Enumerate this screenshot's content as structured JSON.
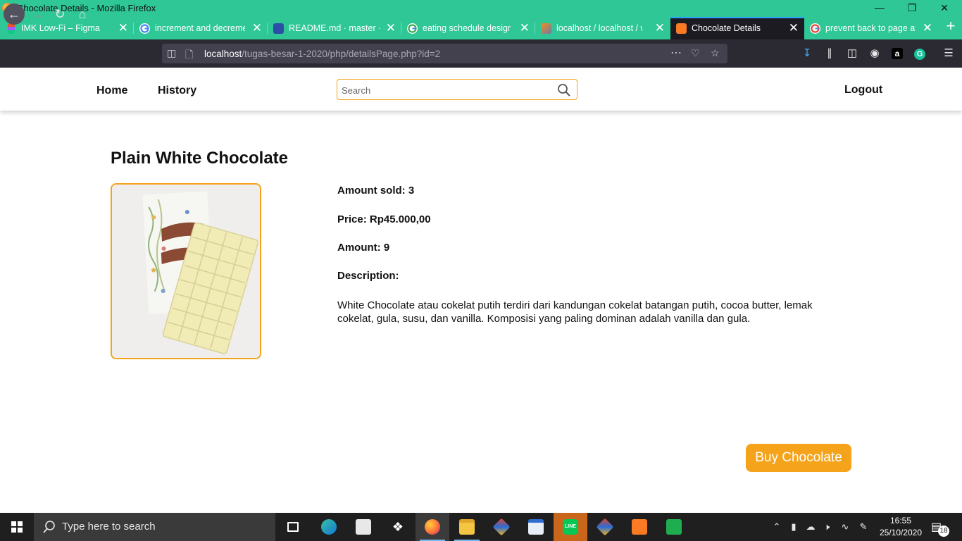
{
  "browser": {
    "window_title": "Chocolate Details - Mozilla Firefox",
    "tabs": [
      {
        "label": "IMK Low-Fi – Figma",
        "icon": "figma-icon"
      },
      {
        "label": "increment and decreme",
        "icon": "google-icon"
      },
      {
        "label": "README.md · master · IF",
        "icon": "gitlab-icon"
      },
      {
        "label": "eating schedule design",
        "icon": "google-icon"
      },
      {
        "label": "localhost / localhost / w",
        "icon": "phpmyadmin-icon"
      },
      {
        "label": "Chocolate Details",
        "icon": "xampp-icon"
      },
      {
        "label": "prevent back to page aft",
        "icon": "google-icon"
      }
    ],
    "url_host": "localhost",
    "url_path": "/tugas-besar-1-2020/php/detailsPage.php?id=2"
  },
  "site": {
    "nav": {
      "home": "Home",
      "history": "History",
      "logout": "Logout"
    },
    "search_placeholder": "Search"
  },
  "product": {
    "name": "Plain White Chocolate",
    "image_alt": "White chocolate bar on wrapper",
    "amount_sold": "Amount sold: 3",
    "price": "Price: Rp45.000,00",
    "amount": "Amount: 9",
    "description_label": "Description:",
    "description": "White Chocolate atau cokelat putih terdiri dari kandungan cokelat batangan putih, cocoa butter, lemak cokelat, gula, susu, dan vanilla. Komposisi yang paling dominan adalah vanilla dan gula.",
    "buy_label": "Buy Chocolate"
  },
  "taskbar": {
    "search_placeholder": "Type here to search",
    "time": "16:55",
    "date": "25/10/2020",
    "notification_count": "18"
  },
  "colors": {
    "accent": "#f5a31a",
    "titlebar": "#2ec795"
  }
}
